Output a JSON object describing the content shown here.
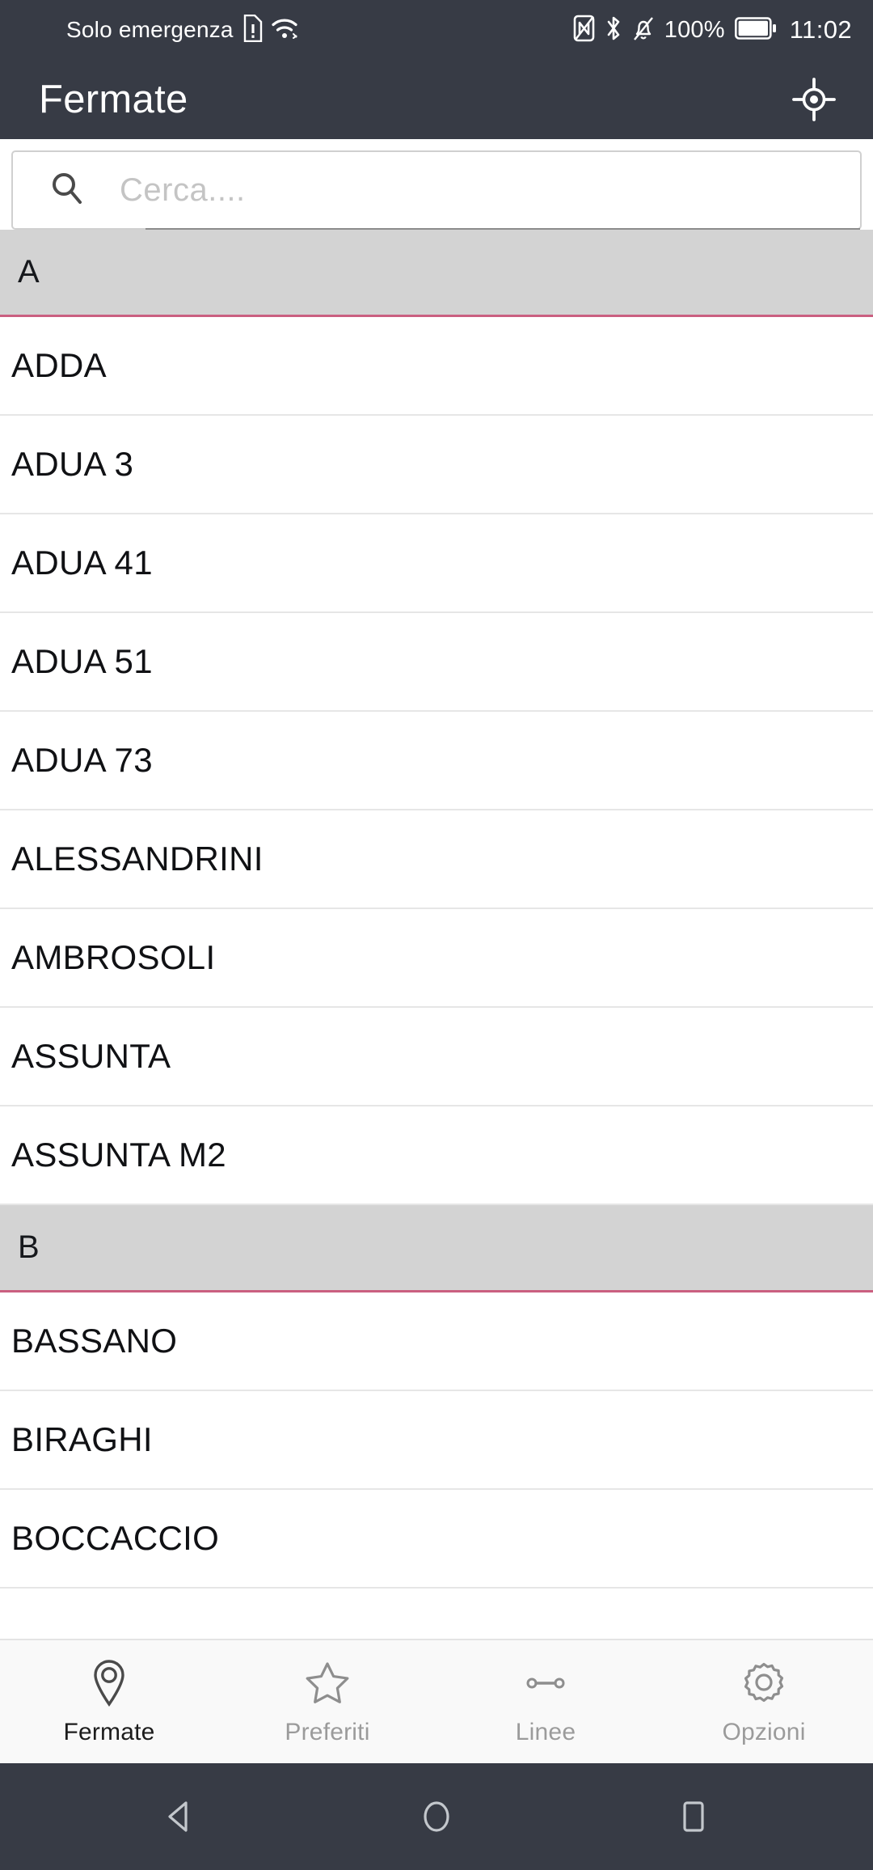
{
  "status_bar": {
    "carrier": "Solo emergenza",
    "sim_icon": "sim-alert-icon",
    "wifi_icon": "wifi-icon",
    "nfc_icon": "nfc-icon",
    "bluetooth_icon": "bluetooth-icon",
    "mute_icon": "bell-muted-icon",
    "battery_percent": "100%",
    "battery_icon": "battery-full-icon",
    "time": "11:02"
  },
  "app_bar": {
    "title": "Fermate",
    "action_icon": "my-location-icon",
    "background": "#373b45",
    "text_color": "#ffffff"
  },
  "search": {
    "icon": "search-icon",
    "placeholder": "Cerca....",
    "value": ""
  },
  "list": {
    "section_header_bg": "#d3d3d3",
    "section_header_accent": "#ca5f80",
    "sections": [
      {
        "letter": "A",
        "stops": [
          "ADDA",
          "ADUA 3",
          "ADUA 41",
          "ADUA 51",
          "ADUA 73",
          "ALESSANDRINI",
          "AMBROSOLI",
          "ASSUNTA",
          "ASSUNTA M2"
        ]
      },
      {
        "letter": "B",
        "stops": [
          "BASSANO",
          "BIRAGHI",
          "BOCCACCIO"
        ]
      }
    ]
  },
  "bottom_nav": {
    "active_index": 0,
    "active_color": "#1c1c1c",
    "inactive_color": "#9b9b9b",
    "items": [
      {
        "label": "Fermate",
        "icon": "map-pin-icon"
      },
      {
        "label": "Preferiti",
        "icon": "star-icon"
      },
      {
        "label": "Linee",
        "icon": "line-route-icon"
      },
      {
        "label": "Opzioni",
        "icon": "gear-icon"
      }
    ]
  },
  "system_nav": {
    "back_icon": "back-triangle-icon",
    "home_icon": "home-circle-icon",
    "recents_icon": "recents-square-icon"
  }
}
